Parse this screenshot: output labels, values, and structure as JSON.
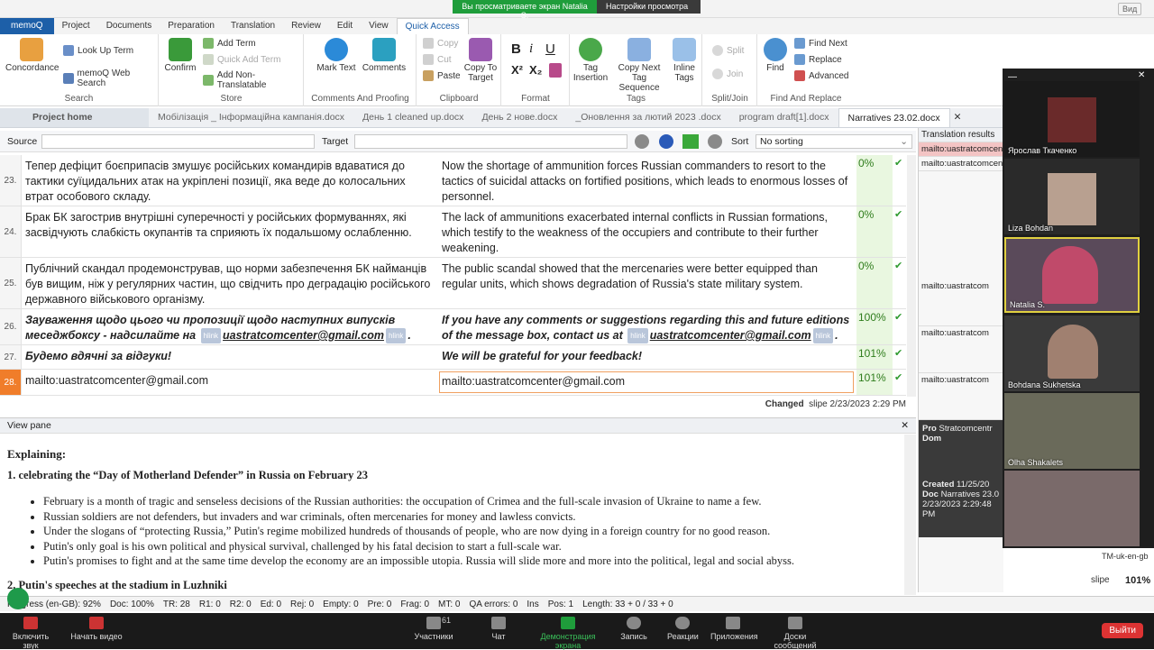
{
  "zoom_banner": {
    "viewing": "Вы просматриваете экран Natalia S.",
    "settings": "Настройки просмотра",
    "view_btn": "Вид"
  },
  "menu": [
    "memoQ",
    "Project",
    "Documents",
    "Preparation",
    "Translation",
    "Review",
    "Edit",
    "View",
    "Quick Access"
  ],
  "ribbon": {
    "search": {
      "label": "Search",
      "concordance": "Concordance",
      "look_up_term": "Look Up Term",
      "web_search": "memoQ Web Search"
    },
    "store": {
      "label": "Store",
      "confirm": "Confirm",
      "add_term": "Add Term",
      "quick_add_term": "Quick Add Term",
      "add_non_translatable": "Add Non-Translatable"
    },
    "comments": {
      "label": "Comments And Proofing",
      "mark_text": "Mark Text",
      "comments": "Comments"
    },
    "clipboard": {
      "label": "Clipboard",
      "copy": "Copy",
      "cut": "Cut",
      "paste": "Paste",
      "copy_to_target": "Copy To Target"
    },
    "format": {
      "label": "Format"
    },
    "tags": {
      "label": "Tags",
      "tag_insertion": "Tag Insertion",
      "copy_next": "Copy Next Tag Sequence",
      "inline_tags": "Inline Tags"
    },
    "splitjoin": {
      "label": "Split/Join",
      "split": "Split",
      "join": "Join"
    },
    "findreplace": {
      "label": "Find And Replace",
      "find": "Find",
      "find_next": "Find Next",
      "replace": "Replace",
      "advanced": "Advanced"
    }
  },
  "tabs": [
    "Project home",
    "Мобілізація _ Інформаційна кампанія.docx",
    "День 1 cleaned up.docx",
    "День 2 нове.docx",
    "_Оновлення за лютий 2023 .docx",
    "program draft[1].docx",
    "Narratives 23.02.docx"
  ],
  "filter": {
    "source": "Source",
    "target": "Target",
    "sort": "Sort",
    "sort_value": "No sorting"
  },
  "rows": [
    {
      "n": "23.",
      "src": "Тепер дефіцит боєприпасів змушує російських командирів вдаватися до тактики суїцидальних атак на укріплені позиції, яка веде до колосальних втрат особового складу.",
      "tgt": "Now the shortage of ammunition forces Russian commanders to resort to the tactics of suicidal attacks on fortified positions, which leads to enormous losses of personnel.",
      "pct": "0%"
    },
    {
      "n": "24.",
      "src": "Брак БК загострив внутрішні суперечності у російських формуваннях, які засвідчують слабкість окупантів та сприяють їх подальшому ослабленню.",
      "tgt": "The lack of ammunitions exacerbated internal conflicts in Russian formations, which testify to the weakness of the occupiers and contribute to their further weakening.",
      "pct": "0%"
    },
    {
      "n": "25.",
      "src": "Публічний скандал продемонстрував, що норми забезпечення БК найманців був вищим, ніж у регулярних частин, що свідчить про деградацію російського державного військового організму.",
      "tgt": "The public scandal showed that the mercenaries were better equipped than regular units, which shows degradation of Russia's state military system.",
      "pct": "0%"
    },
    {
      "n": "26.",
      "src_a": "Зауваження щодо цього чи пропозиції щодо наступних випусків меседжбоксу - надсилайте на",
      "src_b": "uastratcomcenter@gmail.com",
      "tgt_a": "If you have any comments or suggestions regarding this and future editions of the message box, contact us at",
      "tgt_b": "uastratcomcenter@gmail.com",
      "tag": "hlink",
      "pct": "100%"
    },
    {
      "n": "27.",
      "src": "Будемо вдячні за відгуки!",
      "tgt": "We will be grateful for your feedback!",
      "pct": "101%"
    },
    {
      "n": "28.",
      "src": "mailto:uastratcomcenter@gmail.com",
      "tgt": "mailto:uastratcomcenter@gmail.com",
      "pct": "101%"
    }
  ],
  "changed": {
    "label": "Changed",
    "info": "slipe 2/23/2023 2:29 PM"
  },
  "viewpane": {
    "header": "View pane",
    "title": "Explaining:",
    "item1": "1.    celebrating the “Day of Motherland Defender” in Russia on February 23",
    "bullets": [
      "February is a month of tragic and senseless decisions of the Russian authorities: the occupation of Crimea and the full-scale invasion of Ukraine to name a few.",
      "Russian soldiers are not defenders, but invaders and war criminals, often mercenaries for money and lawless convicts.",
      "Under the slogans of “protecting Russia,” Putin's regime mobilized hundreds of thousands of people, who are now dying in a foreign country for no good reason.",
      "Putin's only goal is his own political and physical survival, challenged by his fatal decision to start a full-scale war.",
      "Putin's promises to fight and at the same time develop the economy are an impossible utopia. Russia will slide more and more into the political, legal and social abyss."
    ],
    "item2": "2.    Putin's speeches at the stadium in Luzhniki"
  },
  "status": [
    "Progress (en-GB): 92%",
    "Doc: 100%",
    "TR: 28",
    "R1: 0",
    "R2: 0",
    "Ed: 0",
    "Rej: 0",
    "Empty: 0",
    "Pre: 0",
    "Frag: 0",
    "MT: 0",
    "QA errors: 0",
    "Ins",
    "Pos: 1",
    "Length: 33 + 0 / 33 + 0"
  ],
  "rpanel": {
    "title": "Translation results",
    "results": [
      "mailto:uastratcomcenter@gmail.com",
      "mailto:uastratcomcenter@gmail.com"
    ],
    "lower": [
      "mailto:uastratcom",
      "mailto:uastratcom",
      "mailto:uastratcom"
    ],
    "meta": {
      "pro": "Pro",
      "pro_val": "Stratcomcentr",
      "dom": "Dom",
      "created": "Created",
      "created_val": "11/25/20",
      "doc": "Doc",
      "doc_val": "Narratives 23.0",
      "date": "2/23/2023 2:29:48 PM",
      "tm": "TM-uk-en-gb",
      "user": "slipe",
      "zoom": "101%"
    }
  },
  "participants": [
    "Ярослав Ткаченко",
    "Liza Bohdan",
    "Natalia S.",
    "Bohdana Sukhetska",
    "Olha Shakalets"
  ],
  "zoombar": {
    "mute": "Включить звук",
    "video": "Начать видео",
    "participants": "Участники",
    "participants_count": "61",
    "chat": "Чат",
    "share": "Демонстрация экрана",
    "record": "Запись",
    "reactions": "Реакции",
    "apps": "Приложения",
    "whiteboard": "Доски сообщений",
    "leave": "Выйти"
  },
  "colors": {
    "accent": "#1d5fa8",
    "current_row": "#f07d2a",
    "match_green": "#e9f7e0",
    "zoom_green": "#1f9d3b"
  }
}
